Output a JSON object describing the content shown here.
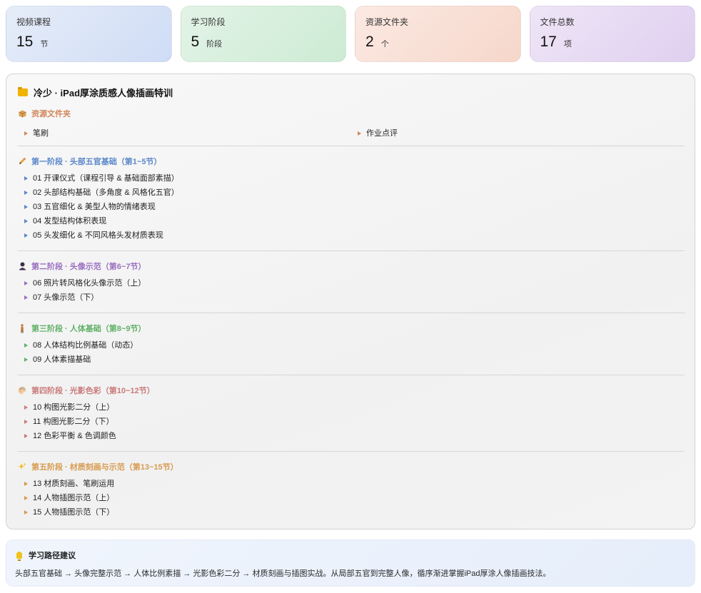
{
  "stats": [
    {
      "label": "视频课程",
      "value": "15",
      "unit": "节"
    },
    {
      "label": "学习阶段",
      "value": "5",
      "unit": "阶段"
    },
    {
      "label": "资源文件夹",
      "value": "2",
      "unit": "个"
    },
    {
      "label": "文件总数",
      "value": "17",
      "unit": "项"
    }
  ],
  "course": {
    "title": "冷少 · iPad厚涂质感人像插画特训",
    "icon": "folder-icon"
  },
  "resources": {
    "heading": "资源文件夹",
    "icon": "package-icon",
    "items": [
      "笔刷",
      "作业点评"
    ]
  },
  "stages": [
    {
      "heading": "第一阶段 · 头部五官基础（第1~5节）",
      "icon": "pencil-icon",
      "color": "#5b87c9",
      "items": [
        "01 开课仪式（课程引导 & 基础面部素描）",
        "02 头部结构基础（多角度 & 风格化五官）",
        "03 五官细化 & 美型人物的情绪表现",
        "04 发型结构体积表现",
        "05 头发细化 & 不同风格头发材质表现"
      ]
    },
    {
      "heading": "第二阶段 · 头像示范（第6~7节）",
      "icon": "person-bust-icon",
      "color": "#9a6fc0",
      "items": [
        "06 照片转风格化头像示范（上）",
        "07 头像示范（下）"
      ]
    },
    {
      "heading": "第三阶段 · 人体基础（第8~9节）",
      "icon": "standing-person-icon",
      "color": "#61b068",
      "items": [
        "08 人体结构比例基础（动态）",
        "09 人体素描基础"
      ]
    },
    {
      "heading": "第四阶段 · 光影色彩（第10~12节）",
      "icon": "palette-icon",
      "color": "#c97a7a",
      "items": [
        "10 构图光影二分（上）",
        "11 构图光影二分（下）",
        "12 色彩平衡 & 色调颜色"
      ]
    },
    {
      "heading": "第五阶段 · 材质刻画与示范（第13~15节）",
      "icon": "sparkles-icon",
      "color": "#d79a4e",
      "items": [
        "13 材质刻画、笔刷运用",
        "14 人物插图示范（上）",
        "15 人物插图示范（下）"
      ]
    }
  ],
  "tip": {
    "heading": "学习路径建议",
    "icon": "lightbulb-icon",
    "text": "头部五官基础 → 头像完整示范 → 人体比例素描 → 光影色彩二分 → 材质刻画与插图实战。从局部五官到完整人像，循序渐进掌握iPad厚涂人像插画技法。"
  }
}
